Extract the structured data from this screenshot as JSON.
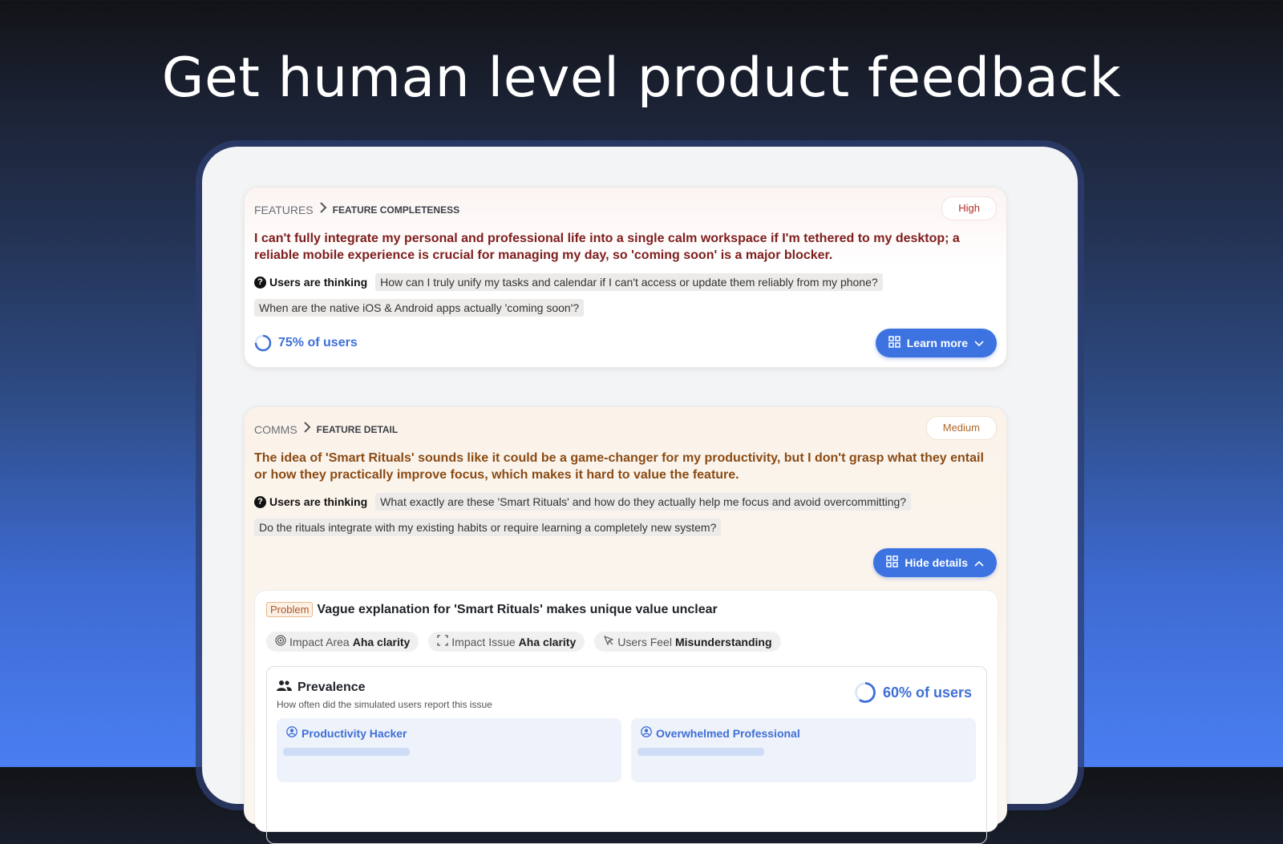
{
  "hero": {
    "title": "Get human level product feedback"
  },
  "cards": [
    {
      "breadcrumb_root": "FEATURES",
      "breadcrumb_leaf": "FEATURE COMPLETENESS",
      "priority": "High",
      "headline": "I can't fully integrate my personal and professional life into a single calm workspace if I'm tethered to my desktop; a reliable mobile experience is crucial for managing my day, so 'coming soon' is a major blocker.",
      "thinking_label": "Users are thinking",
      "thoughts": [
        "How can I truly unify my tasks and calendar if I can't access or update them reliably from my phone?",
        "When are the native iOS & Android apps actually 'coming soon'?"
      ],
      "users_pct": 75,
      "users_text": "75% of users",
      "button_label": "Learn more"
    },
    {
      "breadcrumb_root": "COMMS",
      "breadcrumb_leaf": "FEATURE DETAIL",
      "priority": "Medium",
      "headline": "The idea of 'Smart Rituals' sounds like it could be a game-changer for my productivity, but I don't grasp what they entail or how they practically improve focus, which makes it hard to value the feature.",
      "thinking_label": "Users are thinking",
      "thoughts": [
        "What exactly are these 'Smart Rituals' and how do they actually help me focus and avoid overcommitting?",
        "Do the rituals integrate with my existing habits or require learning a completely new system?"
      ],
      "button_label": "Hide details",
      "problem": {
        "tag": "Problem",
        "title": "Vague explanation for 'Smart Rituals' makes unique value unclear",
        "pills": [
          {
            "label": "Impact Area",
            "value": "Aha clarity",
            "icon": "target-icon"
          },
          {
            "label": "Impact Issue",
            "value": "Aha clarity",
            "icon": "frame-icon"
          },
          {
            "label": "Users Feel",
            "value": "Misunderstanding",
            "icon": "cursor-icon"
          }
        ],
        "prevalence": {
          "title": "Prevalence",
          "subtitle": "How often did the simulated users report this issue",
          "users_pct": 60,
          "users_text": "60% of users",
          "personas": [
            "Productivity Hacker",
            "Overwhelmed Professional"
          ]
        }
      }
    }
  ],
  "colors": {
    "accent": "#3c73e0",
    "high": "#b32b2b",
    "medium": "#b0672a"
  }
}
